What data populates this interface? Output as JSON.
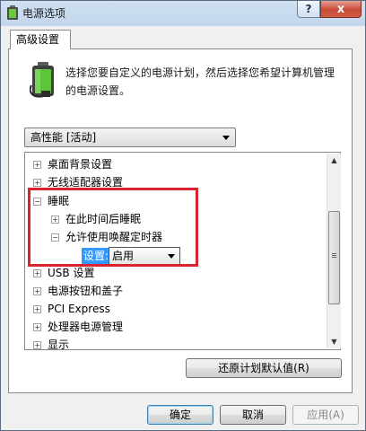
{
  "window": {
    "title": "电源选项"
  },
  "titlebar": {
    "help": "?",
    "close": "x"
  },
  "tab": {
    "label": "高级设置"
  },
  "description": "选择您要自定义的电源计划，然后选择您希望计算机管理的电源设置。",
  "plan": {
    "selected": "高性能 [活动]"
  },
  "tree": {
    "items": [
      {
        "label": "桌面背景设置",
        "expander": "+"
      },
      {
        "label": "无线适配器设置",
        "expander": "+"
      },
      {
        "label": "睡眠",
        "expander": "−"
      },
      {
        "label": "在此时间后睡眠",
        "expander": "+"
      },
      {
        "label": "允许使用唤醒定时器",
        "expander": "−"
      },
      {
        "label": "USB 设置",
        "expander": "+"
      },
      {
        "label": "电源按钮和盖子",
        "expander": "+"
      },
      {
        "label": "PCI Express",
        "expander": "+"
      },
      {
        "label": "处理器电源管理",
        "expander": "+"
      },
      {
        "label": "显示",
        "expander": "+"
      }
    ],
    "setting": {
      "label": "设置:",
      "value": "启用"
    }
  },
  "buttons": {
    "restore": "还原计划默认值(R)",
    "ok": "确定",
    "cancel": "取消",
    "apply": "应用(A)"
  },
  "colors": {
    "highlight": "#d9232e",
    "selection": "#3399ff"
  }
}
